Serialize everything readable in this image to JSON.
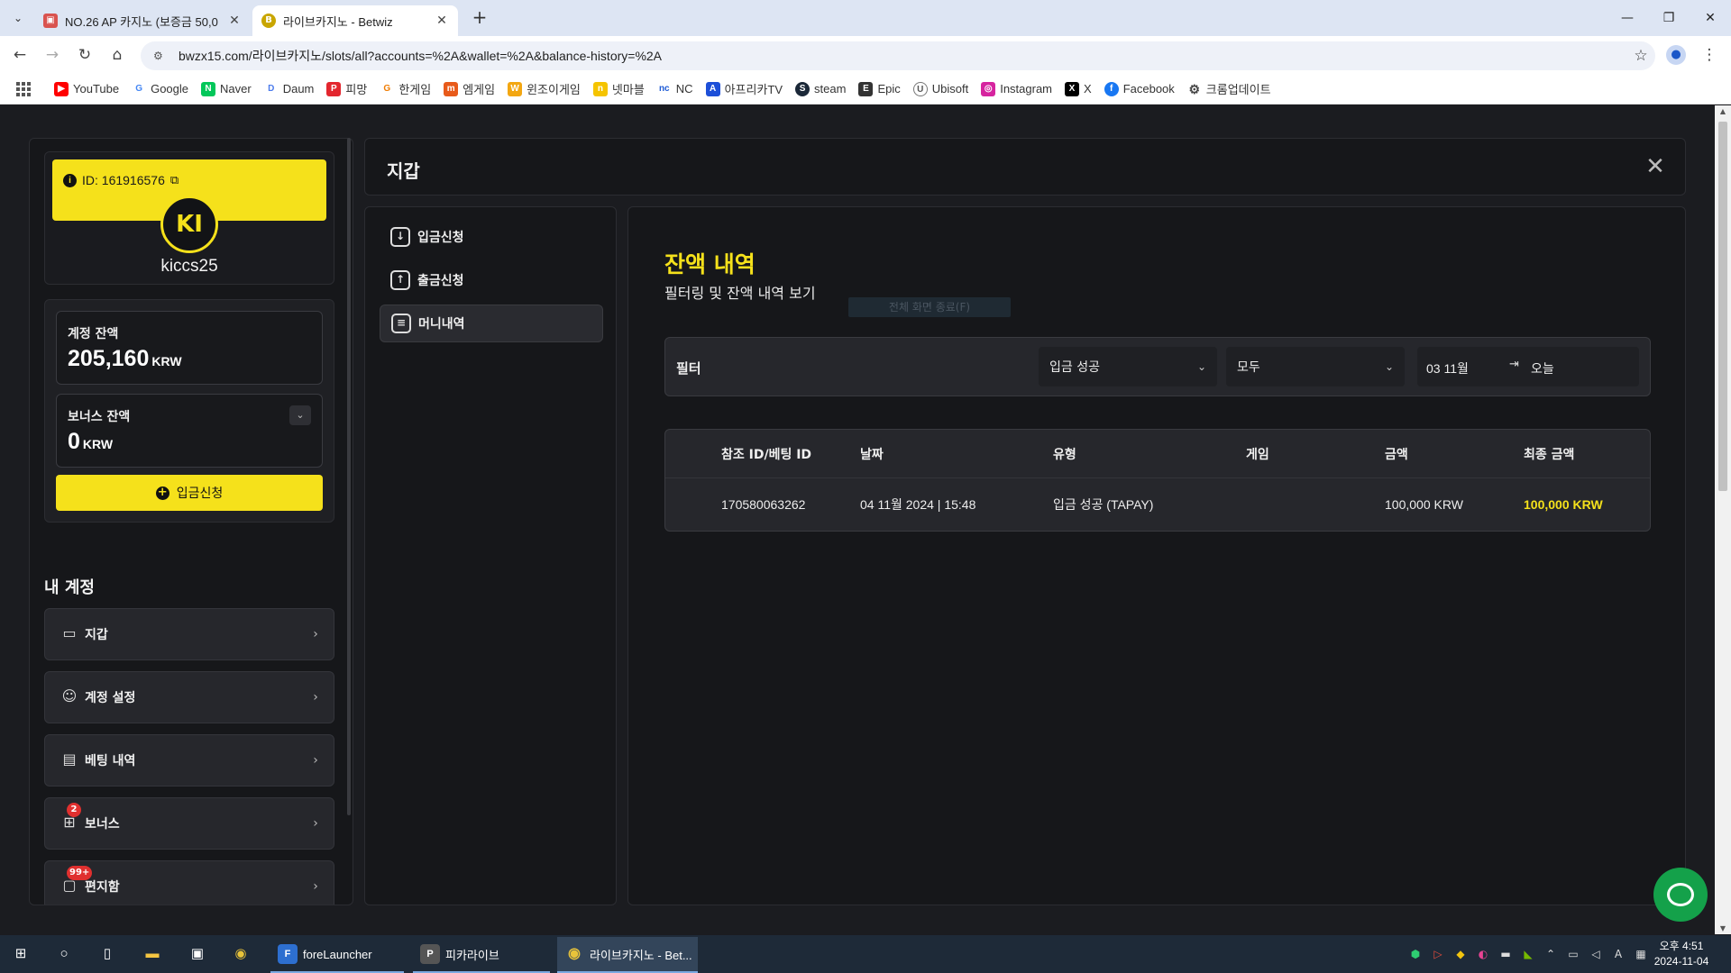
{
  "browser": {
    "tabs": [
      {
        "title": "NO.26 AP 카지노 (보증금 50,0",
        "active": false
      },
      {
        "title": "라이브카지노 - Betwiz",
        "active": true
      }
    ],
    "url": "bwzx15.com/라이브카지노/slots/all?accounts=%2A&wallet=%2A&balance-history=%2A",
    "bookmarks": [
      "YouTube",
      "Google",
      "Naver",
      "Daum",
      "피망",
      "한게임",
      "엠게임",
      "윈조이게임",
      "넷마블",
      "NC",
      "아프리카TV",
      "steam",
      "Epic",
      "Ubisoft",
      "Instagram",
      "X",
      "Facebook",
      "크롬업데이트"
    ]
  },
  "profile": {
    "id_label": "ID: 161916576",
    "initials": "KI",
    "username": "kiccs25"
  },
  "balances": {
    "account_label": "계정 잔액",
    "account_amount": "205,160",
    "account_currency": "KRW",
    "bonus_label": "보너스 잔액",
    "bonus_amount": "0",
    "bonus_currency": "KRW",
    "deposit_button": "입금신청"
  },
  "my_account": {
    "heading": "내 계정",
    "items": [
      {
        "label": "지갑",
        "icon": "wallet-icon"
      },
      {
        "label": "계정 설정",
        "icon": "user-settings-icon"
      },
      {
        "label": "베팅 내역",
        "icon": "receipt-icon"
      },
      {
        "label": "보너스",
        "icon": "gift-icon",
        "badge": "2"
      },
      {
        "label": "편지함",
        "icon": "message-icon",
        "badge": "99+"
      }
    ]
  },
  "wallet": {
    "title": "지갑",
    "nav": [
      {
        "label": "입금신청",
        "icon": "download-icon"
      },
      {
        "label": "출금신청",
        "icon": "upload-icon"
      },
      {
        "label": "머니내역",
        "icon": "document-icon"
      }
    ]
  },
  "history": {
    "title": "잔액 내역",
    "subtitle": "필터링 및 잔액 내역 보기",
    "faded_button": "전체 화면 종료(F)",
    "filter": {
      "label": "필터",
      "type_value": "입금 성공",
      "game_value": "모두",
      "date_from": "03 11월",
      "date_to": "오늘"
    },
    "columns": [
      "참조 ID/베팅 ID",
      "날짜",
      "유형",
      "게임",
      "금액",
      "최종 금액"
    ],
    "rows": [
      {
        "ref": "170580063262",
        "date": "04 11월 2024 | 15:48",
        "type": "입금 성공 (TAPAY)",
        "game": "",
        "amount": "100,000 KRW",
        "final": "100,000 KRW"
      }
    ]
  },
  "taskbar": {
    "apps": [
      "foreLauncher",
      "피카라이브",
      "라이브카지노 - Bet..."
    ],
    "time": "오후 4:51",
    "date": "2024-11-04"
  },
  "colors": {
    "accent": "#f5e11b",
    "panel": "#16171a",
    "card": "#26272c",
    "chat": "#14a14a"
  }
}
